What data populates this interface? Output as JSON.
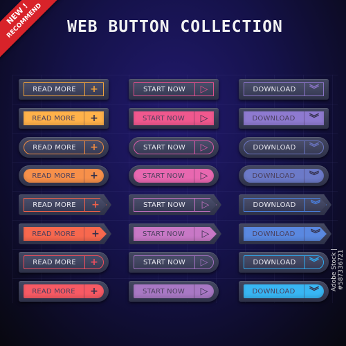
{
  "title": "WEB BUTTON COLLECTION",
  "ribbon": {
    "line1": "NEW !",
    "line2": "RECOMMEND"
  },
  "credit": "Adobe Stock | #587336721",
  "columns": [
    {
      "label": "READ MORE",
      "icon": "plus-icon",
      "glyph": "+",
      "row_colors": [
        "#f0a23c",
        "#ffb24a",
        "#ee8a42",
        "#f7904a",
        "#f0604a",
        "#f7684e",
        "#f04e5e",
        "#f75a64"
      ]
    },
    {
      "label": "START NOW",
      "icon": "play-icon",
      "glyph": "▷",
      "row_colors": [
        "#e0508c",
        "#f0588e",
        "#d85aa8",
        "#e868b0",
        "#c070c0",
        "#c878c6",
        "#a070c0",
        "#a878c4"
      ]
    },
    {
      "label": "DOWNLOAD",
      "icon": "chevron-double-down-icon",
      "glyph": "︾",
      "row_colors": [
        "#8a74c6",
        "#8e7ad0",
        "#6a74c0",
        "#6c7ac8",
        "#4a80e0",
        "#5a88e0",
        "#30aaf0",
        "#38b6f4"
      ]
    }
  ]
}
